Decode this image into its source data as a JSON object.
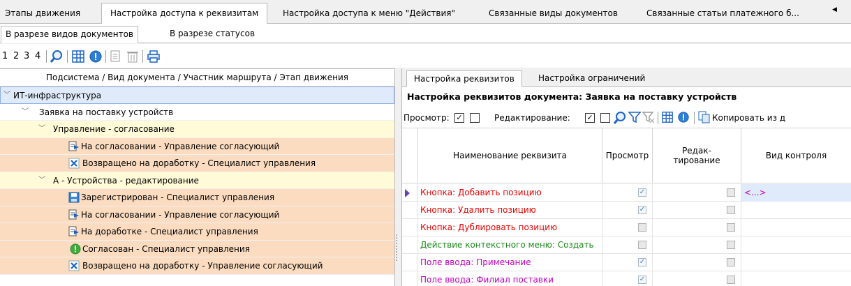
{
  "top_tabs": [
    "Этапы движения",
    "Настройка доступа к реквизитам",
    "Настройка доступа к меню \"Действия\"",
    "Связанные виды документов",
    "Связанные статьи платежного б..."
  ],
  "sub_tabs": [
    "В разрезе видов документов",
    "В разрезе статусов"
  ],
  "toolbar": {
    "levels": [
      "1",
      "2",
      "3",
      "4"
    ]
  },
  "tree": {
    "header": "Подсистема / Вид документа / Участник маршрута / Этап движения",
    "rows": [
      {
        "label": "ИТ-инфраструктура",
        "icon": "none"
      },
      {
        "label": "Заявка на поставку устройств",
        "icon": "none"
      },
      {
        "label": "Управление - согласование",
        "icon": "none"
      },
      {
        "label": "На согласовании - Управление согласующий",
        "icon": "send-doc-icon"
      },
      {
        "label": "Возвращено на доработку - Специалист управления",
        "icon": "cross-icon"
      },
      {
        "label": "А - Устройства - редактирование",
        "icon": "none"
      },
      {
        "label": "Зарегистрирован - Специалист управления",
        "icon": "save-icon"
      },
      {
        "label": "На согласовании - Управление согласующий",
        "icon": "send-doc-icon"
      },
      {
        "label": "На доработке - Специалист управления",
        "icon": "send-doc-icon"
      },
      {
        "label": "Согласован - Специалист управления",
        "icon": "approved-icon"
      },
      {
        "label": "Возвращено на доработку - Управление согласующий",
        "icon": "cross-icon"
      }
    ]
  },
  "right": {
    "tabs": [
      "Настройка реквизитов",
      "Настройка ограничений"
    ],
    "title": "Настройка реквизитов документа:  Заявка на поставку устройств",
    "filter": {
      "view_label": "Просмотр:",
      "edit_label": "Редактирование:",
      "copy_label": "Копировать из д"
    },
    "grid": {
      "headers": {
        "name": "Наименование реквизита",
        "view": "Просмотр",
        "edit_line1": "Редак-",
        "edit_line2": "тирование",
        "control": "Вид контроля"
      },
      "rows": [
        {
          "name": "Кнопка: Добавить позицию",
          "color": "#e60000",
          "view": true,
          "edit": false,
          "control": "<...>",
          "current": true
        },
        {
          "name": "Кнопка: Удалить позицию",
          "color": "#e60000",
          "view": true,
          "edit": false,
          "control": "",
          "current": false
        },
        {
          "name": "Кнопка: Дублировать позицию",
          "color": "#e60000",
          "view": false,
          "edit": false,
          "control": "",
          "current": false
        },
        {
          "name": "Действие контекстного меню: Создать",
          "color": "#1a8a1a",
          "view": false,
          "edit": false,
          "control": "",
          "current": false
        },
        {
          "name": "Поле ввода: Примечание",
          "color": "#c000c0",
          "view": true,
          "edit": false,
          "control": "",
          "current": false
        },
        {
          "name": "Поле ввода: Филиал поставки",
          "color": "#c000c0",
          "view": true,
          "edit": false,
          "control": "",
          "current": false
        }
      ]
    }
  },
  "colors": {
    "selected_row": "#dfeafa",
    "group_row": "#fffbd8",
    "leaf_row": "#fbdcc0",
    "accent": "#3a7bd5"
  }
}
